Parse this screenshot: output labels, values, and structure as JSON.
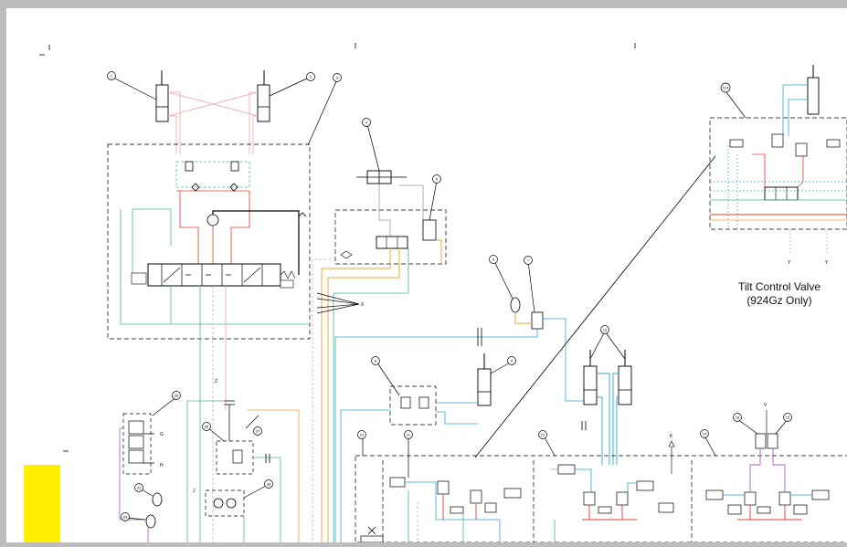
{
  "caption": {
    "line1": "Tilt Control Valve",
    "line2": "(924Gz Only)"
  },
  "callouts": [
    "1",
    "2",
    "3",
    "4",
    "5",
    "6",
    "7",
    "8",
    "9",
    "10",
    "11",
    "12",
    "13",
    "14",
    "15",
    "16",
    "28",
    "30",
    "31",
    "33",
    "36",
    "37",
    "114"
  ],
  "port_labels": {
    "x": "X",
    "z": "Z",
    "g": "G",
    "h": "H",
    "j": "J",
    "k": "K",
    "v": "V",
    "y1": "Y",
    "y2": "Y"
  },
  "colors": {
    "frame": "#bdbdbd",
    "pressure": "#e03c31",
    "pilot": "#f0a030",
    "return": "#2aa8c8",
    "drain": "#4fb88a",
    "load_sense": "#e8a6a6",
    "case_drain": "#a060c0",
    "highlight": "#ffff00"
  }
}
